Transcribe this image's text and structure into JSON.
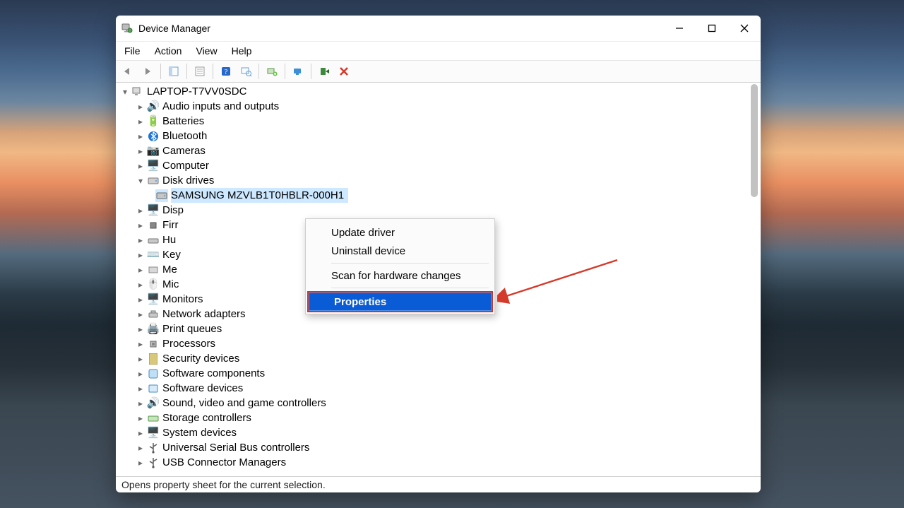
{
  "window": {
    "title": "Device Manager"
  },
  "menu": {
    "file": "File",
    "action": "Action",
    "view": "View",
    "help": "Help"
  },
  "tree": {
    "root": "LAPTOP-T7VV0SDC",
    "n0": "Audio inputs and outputs",
    "n1": "Batteries",
    "n2": "Bluetooth",
    "n3": "Cameras",
    "n4": "Computer",
    "n5": "Disk drives",
    "n5a": "SAMSUNG MZVLB1T0HBLR-000H1",
    "n6": "Disp",
    "n7": "Firr",
    "n8": "Hu",
    "n9": "Key",
    "n10": "Me",
    "n11": "Mic",
    "n12": "Monitors",
    "n13": "Network adapters",
    "n14": "Print queues",
    "n15": "Processors",
    "n16": "Security devices",
    "n17": "Software components",
    "n18": "Software devices",
    "n19": "Sound, video and game controllers",
    "n20": "Storage controllers",
    "n21": "System devices",
    "n22": "Universal Serial Bus controllers",
    "n23": "USB Connector Managers"
  },
  "context_menu": {
    "update": "Update driver",
    "uninstall": "Uninstall device",
    "scan": "Scan for hardware changes",
    "properties": "Properties"
  },
  "status": "Opens property sheet for the current selection."
}
